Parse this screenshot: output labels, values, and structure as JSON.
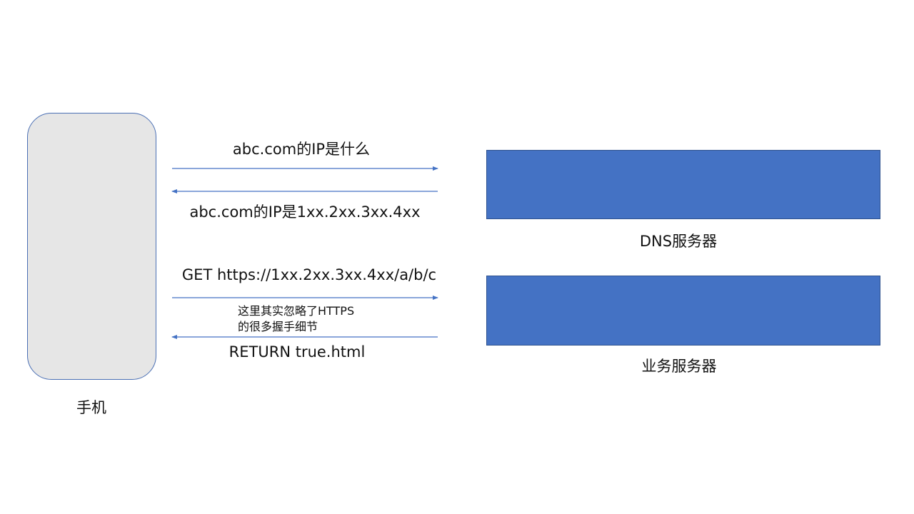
{
  "nodes": {
    "phone": {
      "label": "手机"
    },
    "dns_server": {
      "label": "DNS服务器"
    },
    "business_server": {
      "label": "业务服务器"
    }
  },
  "messages": {
    "dns_query": "abc.com的IP是什么",
    "dns_response": "abc.com的IP是1xx.2xx.3xx.4xx",
    "http_request": "GET https://1xx.2xx.3xx.4xx/a/b/c",
    "http_response": "RETURN true.html"
  },
  "note": {
    "line1": "这里其实忽略了HTTPS",
    "line2": "的很多握手细节"
  },
  "colors": {
    "server_fill": "#4472c4",
    "phone_fill": "#e6e6e6",
    "arrow": "#4472c4"
  }
}
